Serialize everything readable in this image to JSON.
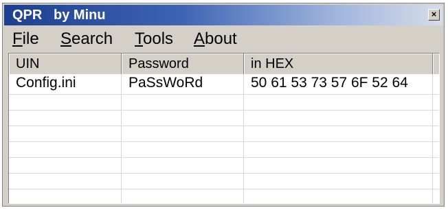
{
  "window": {
    "title": "QPR   by Minu",
    "close_glyph": "×"
  },
  "menu": [
    {
      "accel": "F",
      "rest": "ile"
    },
    {
      "accel": "S",
      "rest": "earch"
    },
    {
      "accel": "T",
      "rest": "ools"
    },
    {
      "accel": "A",
      "rest": "bout"
    }
  ],
  "table": {
    "columns": [
      "UIN",
      "Password",
      "in HEX"
    ],
    "rows": [
      [
        "Config.ini",
        "PaSsWoRd",
        "50 61 53 73 57 6F 52 64"
      ]
    ]
  }
}
